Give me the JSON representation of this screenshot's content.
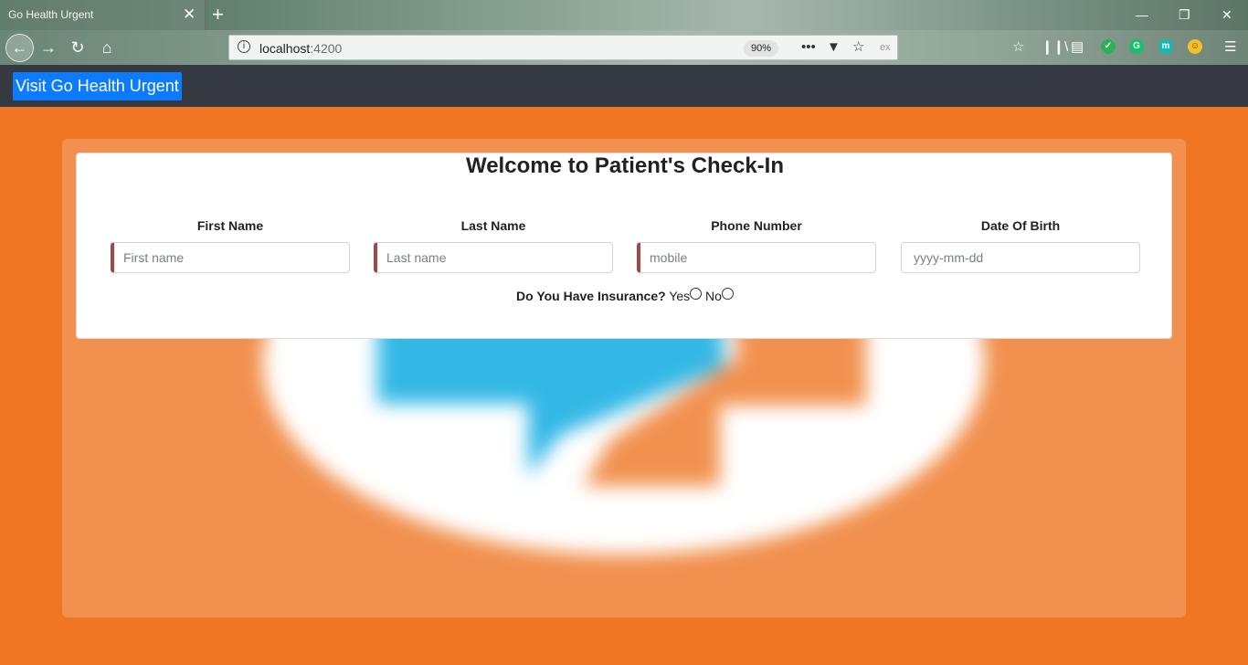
{
  "browser": {
    "tab_title": "Go Health Urgent",
    "tab_close": "✕",
    "new_tab": "+",
    "url_host": "localhost",
    "url_port": ":4200",
    "zoom": "90%",
    "win_minimize": "—",
    "win_restore": "❐",
    "win_close": "✕"
  },
  "nav": {
    "visit_button": "Visit Go Health Urgent"
  },
  "form": {
    "title": "Welcome to Patient's Check-In",
    "fields": [
      {
        "label": "First Name",
        "placeholder": "First name",
        "value": ""
      },
      {
        "label": "Last Name",
        "placeholder": "Last name",
        "value": ""
      },
      {
        "label": "Phone Number",
        "placeholder": "mobile",
        "value": ""
      },
      {
        "label": "Date Of Birth",
        "placeholder": "yyyy-mm-dd",
        "value": ""
      }
    ],
    "insurance_question": "Do You Have Insurance?",
    "insurance_yes": "Yes",
    "insurance_no": "No"
  },
  "colors": {
    "page_background": "#f07623",
    "nav_background": "#343a40",
    "button_primary": "#0d7bff",
    "required_accent": "#a94442",
    "logo_blue": "#33b8e6"
  }
}
